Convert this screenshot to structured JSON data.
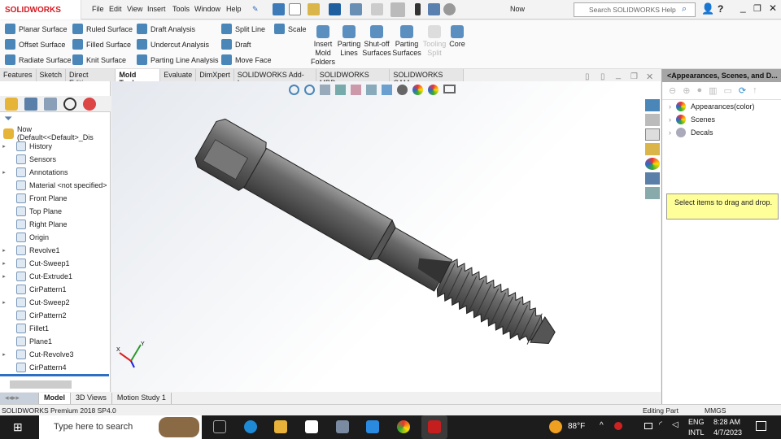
{
  "app": {
    "logo": "SOLIDWORKS",
    "doc_title": "Now",
    "search_placeholder": "Search SOLIDWORKS Help"
  },
  "menu": [
    "File",
    "Edit",
    "View",
    "Insert",
    "Tools",
    "Window",
    "Help"
  ],
  "ribbon": {
    "col1": [
      "Planar Surface",
      "Offset Surface",
      "Radiate Surface"
    ],
    "col2": [
      "Ruled Surface",
      "Filled Surface",
      "Knit Surface"
    ],
    "col3": [
      "Draft Analysis",
      "Undercut Analysis",
      "Parting Line Analysis"
    ],
    "col4": [
      "Split Line",
      "Draft",
      "Move Face"
    ],
    "scale": "Scale",
    "big": [
      "Insert Mold Folders",
      "Parting Lines",
      "Shut-off Surfaces",
      "Parting Surfaces",
      "Tooling Split",
      "Core"
    ]
  },
  "tabs": [
    "Features",
    "Sketch",
    "Direct Editing",
    "Mold Tools",
    "Evaluate",
    "DimXpert",
    "SOLIDWORKS Add-Ins",
    "SOLIDWORKS MBD",
    "SOLIDWORKS CAM"
  ],
  "active_tab": "Mold Tools",
  "tree": {
    "root": "Now  (Default<<Default>_Dis",
    "items": [
      {
        "label": "History",
        "exp": true
      },
      {
        "label": "Sensors",
        "exp": false
      },
      {
        "label": "Annotations",
        "exp": true
      },
      {
        "label": "Material <not specified>",
        "exp": false
      },
      {
        "label": "Front Plane",
        "exp": false
      },
      {
        "label": "Top Plane",
        "exp": false
      },
      {
        "label": "Right Plane",
        "exp": false
      },
      {
        "label": "Origin",
        "exp": false
      },
      {
        "label": "Revolve1",
        "exp": true
      },
      {
        "label": "Cut-Sweep1",
        "exp": true
      },
      {
        "label": "Cut-Extrude1",
        "exp": true
      },
      {
        "label": "CirPattern1",
        "exp": false
      },
      {
        "label": "Cut-Sweep2",
        "exp": true
      },
      {
        "label": "CirPattern2",
        "exp": false
      },
      {
        "label": "Fillet1",
        "exp": false
      },
      {
        "label": "Plane1",
        "exp": false
      },
      {
        "label": "Cut-Revolve3",
        "exp": true
      },
      {
        "label": "CirPattern4",
        "exp": false
      }
    ]
  },
  "right_panel": {
    "title": "<Appearances, Scenes, and D...",
    "items": [
      "Appearances(color)",
      "Scenes",
      "Decals"
    ],
    "hint": "Select items to drag and drop."
  },
  "bottom_tabs": [
    "Model",
    "3D Views",
    "Motion Study 1"
  ],
  "status": {
    "product": "SOLIDWORKS Premium 2018 SP4.0",
    "mode": "Editing Part",
    "units": "MMGS"
  },
  "taskbar": {
    "search": "Type here to search",
    "weather": "88°F",
    "lang1": "ENG",
    "lang2": "INTL",
    "time": "8:28 AM",
    "date": "4/7/2023"
  },
  "axes": {
    "x": "X",
    "y": "Y"
  }
}
